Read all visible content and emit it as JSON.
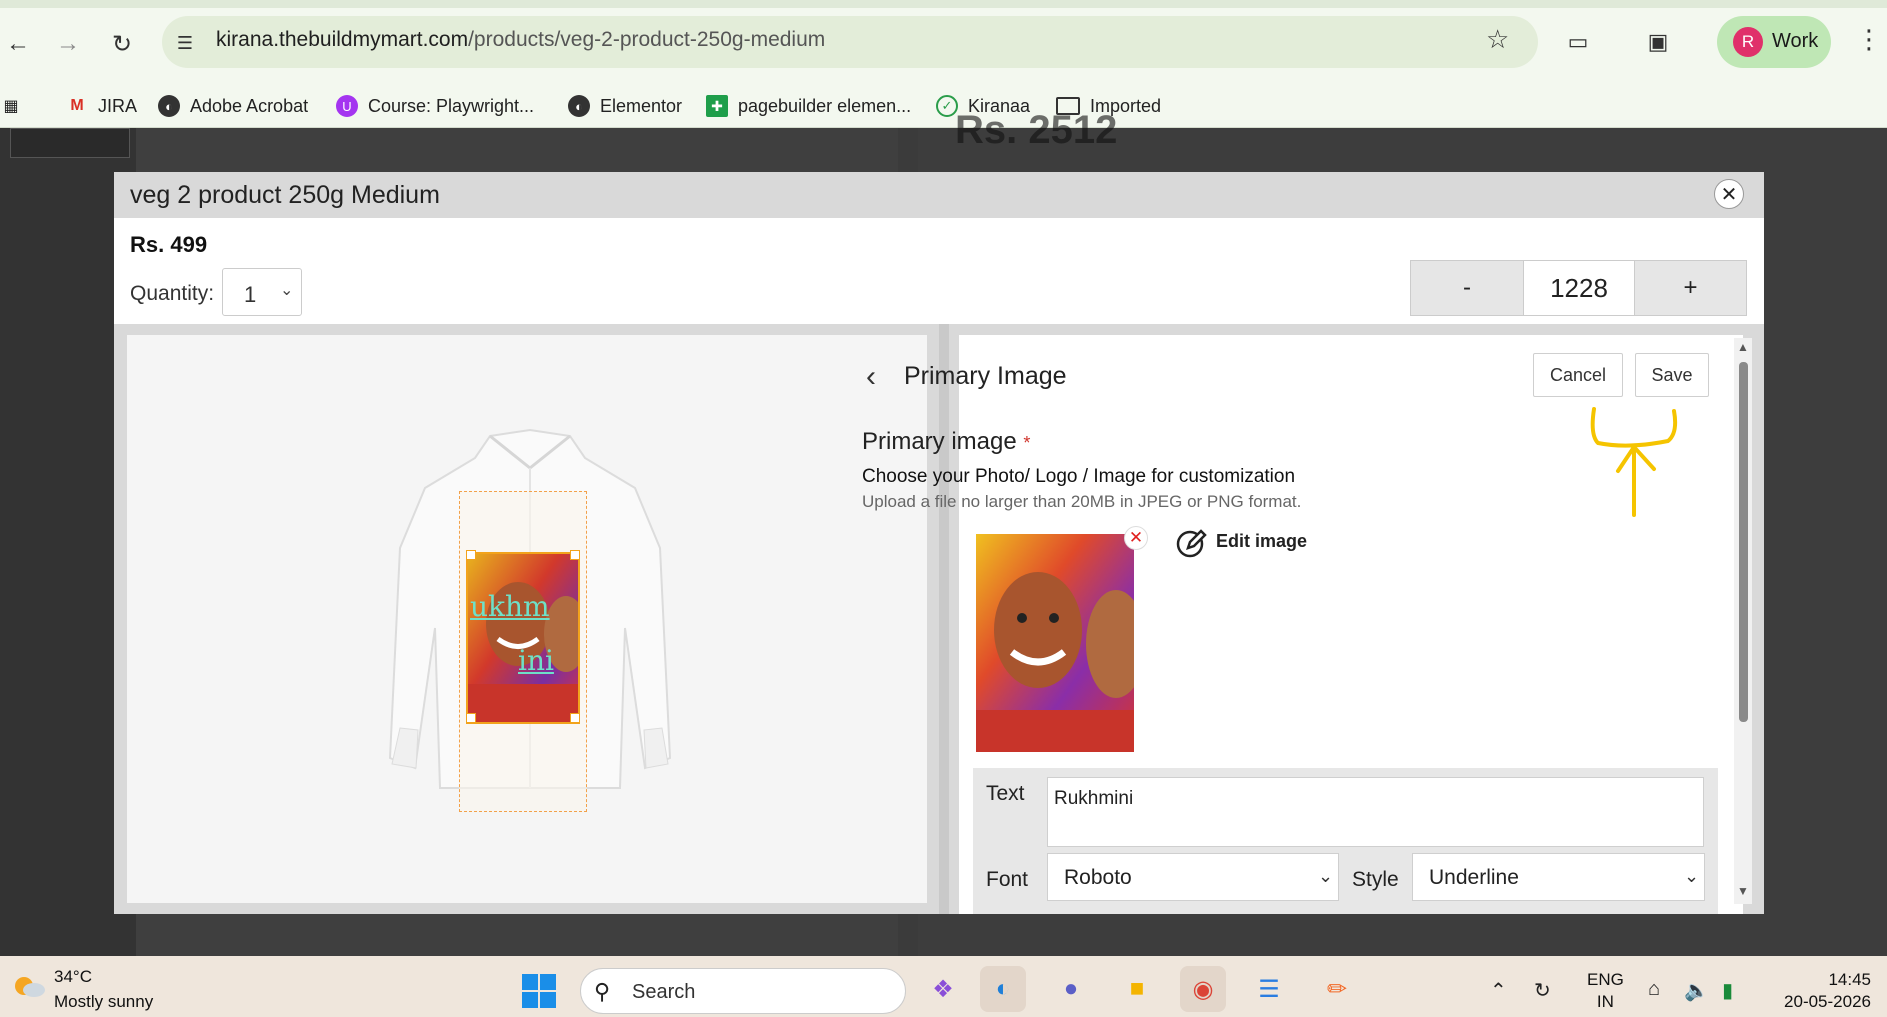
{
  "browser": {
    "url_host": "kirana.thebuildmymart.com",
    "url_path": "/products/veg-2-product-250g-medium",
    "profile_initial": "R",
    "profile_label": "Work"
  },
  "bookmarks": [
    {
      "label": "JIRA",
      "icon": "gmail-icon"
    },
    {
      "label": "Adobe Acrobat",
      "icon": "globe-icon"
    },
    {
      "label": "Course: Playwright...",
      "icon": "udemy-icon"
    },
    {
      "label": "Elementor",
      "icon": "globe-icon"
    },
    {
      "label": "pagebuilder elemen...",
      "icon": "sheets-icon"
    },
    {
      "label": "Kiranaa",
      "icon": "check-icon"
    },
    {
      "label": "Imported",
      "icon": "folder-icon"
    }
  ],
  "background_page": {
    "price_text": "Rs. 2512"
  },
  "modal": {
    "title": "veg 2 product 250g Medium",
    "price": "Rs. 499",
    "quantity_label": "Quantity:",
    "quantity_value": "1",
    "stepper": {
      "minus": "-",
      "value": "1228",
      "plus": "+"
    },
    "close_label": "✕"
  },
  "preview": {
    "overlay_line1": "ukhm",
    "overlay_line2": "ini"
  },
  "editor": {
    "header_title": "Primary Image",
    "cancel_label": "Cancel",
    "save_label": "Save",
    "field_label": "Primary image",
    "required_mark": "*",
    "choose_text": "Choose your Photo/ Logo / Image for customization",
    "upload_hint": "Upload a file no larger than 20MB in JPEG or PNG format.",
    "edit_image_label": "Edit image",
    "text_label": "Text",
    "text_value": "Rukhmini",
    "font_label": "Font",
    "font_value": "Roboto",
    "style_label": "Style",
    "style_value": "Underline"
  },
  "taskbar": {
    "temperature": "34°C",
    "condition": "Mostly sunny",
    "search_placeholder": "Search",
    "lang_line1": "ENG",
    "lang_line2": "IN",
    "time": "14:45",
    "date": "20-05-2026"
  },
  "colors": {
    "accent_orange": "#f2a31c",
    "annotation_yellow": "#f5c400",
    "overlay_text": "#6ee0c8",
    "profile_chip": "#bfe7b5"
  }
}
